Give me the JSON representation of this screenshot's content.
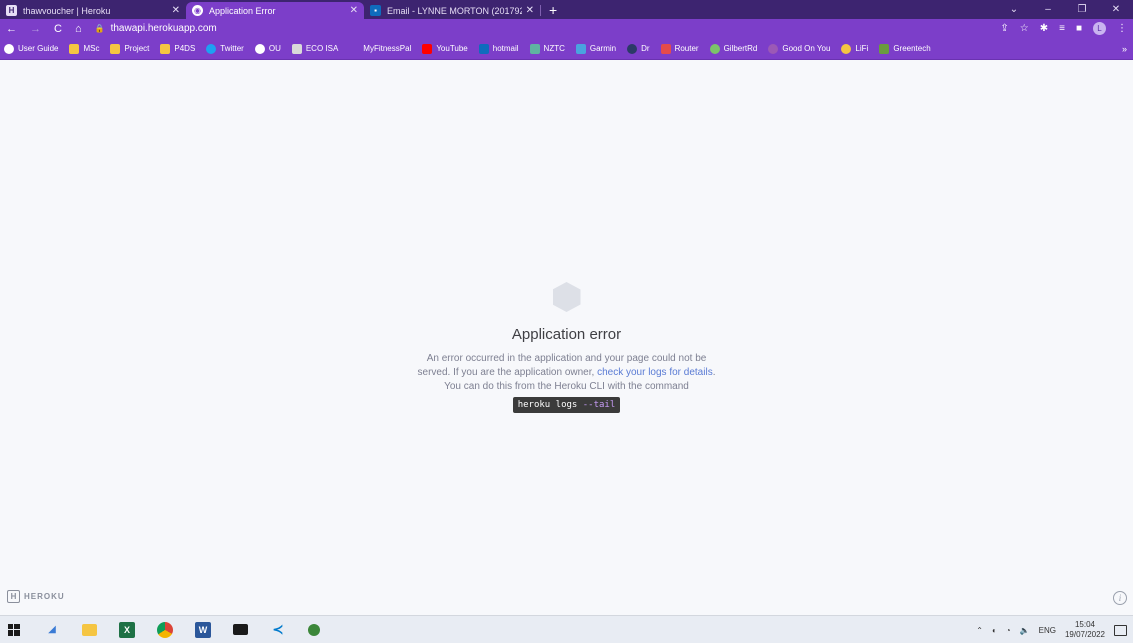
{
  "browser": {
    "tabs": [
      {
        "title": "thawvoucher | Heroku",
        "favicon": "heroku-icon",
        "active": false
      },
      {
        "title": "Application Error",
        "favicon": "globe-icon",
        "active": true
      },
      {
        "title": "Email - LYNNE MORTON (201792",
        "favicon": "outlook-icon",
        "active": false
      }
    ],
    "new_tab": "+",
    "url": "thawapi.herokuapp.com",
    "profile_initial": "L",
    "bookmarks": [
      {
        "label": "User Guide",
        "icon": "globe-icon",
        "color": "#ffffff"
      },
      {
        "label": "MSc",
        "icon": "folder-icon",
        "color": "#f5c542"
      },
      {
        "label": "Project",
        "icon": "folder-icon",
        "color": "#f5c542"
      },
      {
        "label": "P4DS",
        "icon": "folder-icon",
        "color": "#f5c542"
      },
      {
        "label": "Twitter",
        "icon": "twitter-icon",
        "color": "#1da1f2"
      },
      {
        "label": "OU",
        "icon": "globe-icon",
        "color": "#ffffff"
      },
      {
        "label": "ECO ISA",
        "icon": "eco-icon",
        "color": "#d9d9d9"
      },
      {
        "label": "MyFitnessPal",
        "icon": "fitness-icon",
        "color": "#7c3ec9"
      },
      {
        "label": "YouTube",
        "icon": "youtube-icon",
        "color": "#ff0000"
      },
      {
        "label": "hotmail",
        "icon": "outlook-icon",
        "color": "#0f6cbd"
      },
      {
        "label": "NZTC",
        "icon": "nztc-icon",
        "color": "#5fb3a1"
      },
      {
        "label": "Garmin",
        "icon": "garmin-icon",
        "color": "#4aa3df"
      },
      {
        "label": "Dr",
        "icon": "heart-icon",
        "color": "#2b3a67"
      },
      {
        "label": "Router",
        "icon": "router-icon",
        "color": "#e54b4b"
      },
      {
        "label": "GilbertRd",
        "icon": "gilbert-icon",
        "color": "#7cc36a"
      },
      {
        "label": "Good On You",
        "icon": "heart-icon",
        "color": "#9b59b6"
      },
      {
        "label": "LiFi",
        "icon": "bulb-icon",
        "color": "#f5c542"
      },
      {
        "label": "Greentech",
        "icon": "greentech-icon",
        "color": "#6a9b3f"
      }
    ]
  },
  "page": {
    "error_title": "Application error",
    "msg_line1": "An error occurred in the application and your page could not be",
    "msg_line2_before": "served. If you are the application owner, ",
    "msg_link": "check your logs for details",
    "msg_line2_after": ".",
    "msg_line3": "You can do this from the Heroku CLI with the command",
    "cmd_main": "heroku logs ",
    "cmd_flag": "--tail",
    "logo_text": "HEROKU",
    "info_icon_glyph": "i"
  },
  "taskbar": {
    "apps": [
      {
        "icon": "windows-start-icon",
        "color": "#1a1a1a"
      },
      {
        "icon": "search-icon",
        "color": "#3a7bd5"
      },
      {
        "icon": "file-explorer-icon",
        "color": "#f5c542"
      },
      {
        "icon": "excel-icon",
        "color": "#1e7145"
      },
      {
        "icon": "chrome-icon",
        "color": "#db4437"
      },
      {
        "icon": "word-icon",
        "color": "#2b579a"
      },
      {
        "icon": "terminal-icon",
        "color": "#1a1a1a"
      },
      {
        "icon": "vscode-icon",
        "color": "#007acc"
      },
      {
        "icon": "node-icon",
        "color": "#3c873a"
      }
    ],
    "tray": {
      "language": "ENG",
      "time": "15:04",
      "date": "19/07/2022"
    }
  }
}
